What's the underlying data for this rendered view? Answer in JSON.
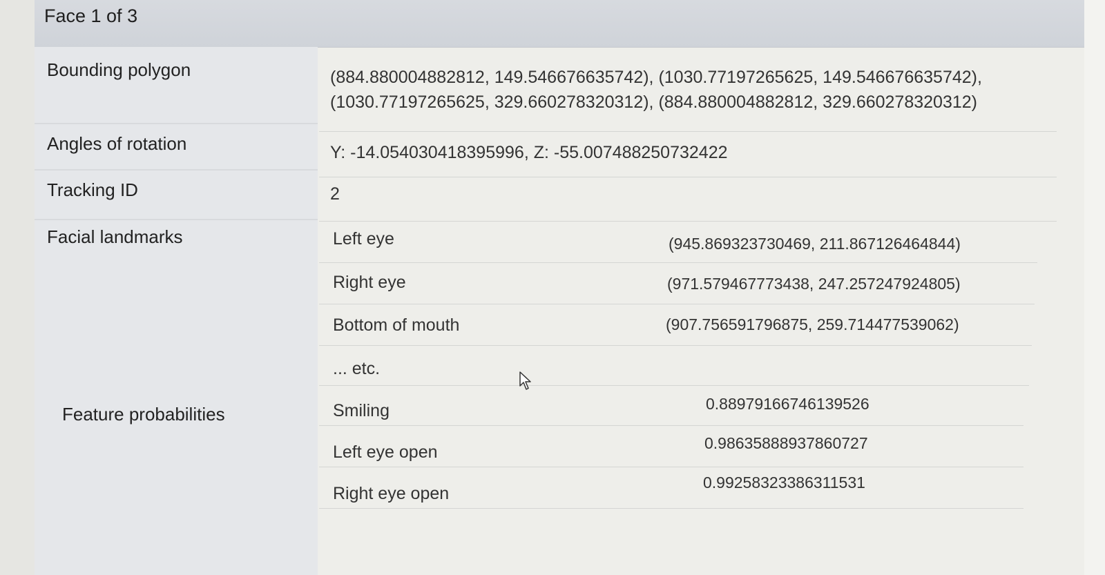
{
  "header": {
    "title": "Face 1 of 3"
  },
  "rows": {
    "bounding_polygon": {
      "label": "Bounding polygon",
      "line1": "(884.880004882812, 149.546676635742), (1030.77197265625, 149.546676635742),",
      "line2": "(1030.77197265625, 329.660278320312), (884.880004882812, 329.660278320312)"
    },
    "angles_of_rotation": {
      "label": "Angles of rotation",
      "value": "Y: -14.054030418395996, Z: -55.007488250732422"
    },
    "tracking_id": {
      "label": "Tracking ID",
      "value": "2"
    },
    "facial_landmarks": {
      "label": "Facial landmarks",
      "items": [
        {
          "name": "Left eye",
          "value": "(945.869323730469, 211.867126464844)"
        },
        {
          "name": "Right eye",
          "value": "(971.579467773438, 247.257247924805)"
        },
        {
          "name": "Bottom of mouth",
          "value": "(907.756591796875, 259.714477539062)"
        }
      ],
      "etc": "... etc."
    },
    "feature_probabilities": {
      "label": "Feature probabilities",
      "items": [
        {
          "name": "Smiling",
          "value": "0.88979166746139526"
        },
        {
          "name": "Left eye open",
          "value": "0.98635888937860727"
        },
        {
          "name": "Right eye open",
          "value": "0.99258323386311531"
        }
      ]
    }
  }
}
